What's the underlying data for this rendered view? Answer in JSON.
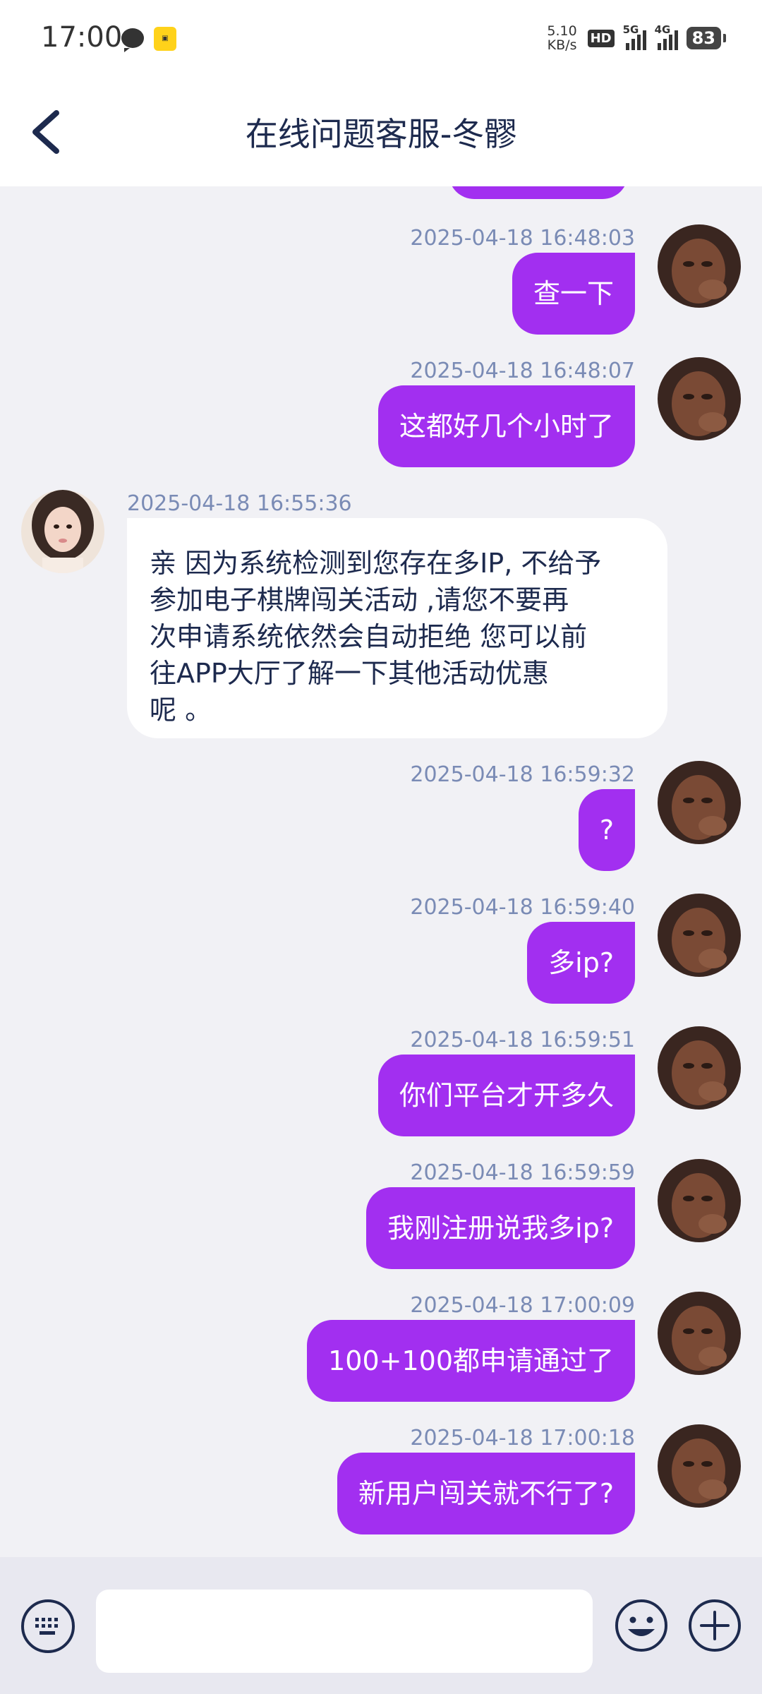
{
  "status": {
    "time": "17:00",
    "speed_top": "5.10",
    "speed_bottom": "KB/s",
    "hd": "HD",
    "net1": "5G",
    "net2": "4G",
    "battery": "83"
  },
  "header": {
    "title": "在线问题客服-冬髎"
  },
  "messages": [
    {
      "side": "right",
      "time": "2025-04-18 16:48:03",
      "text": "查一下"
    },
    {
      "side": "right",
      "time": "2025-04-18 16:48:07",
      "text": "这都好几个小时了"
    },
    {
      "side": "left",
      "time": "2025-04-18 16:55:36",
      "lines": [
        "亲 因为系统检测到您存在多IP, 不给予",
        "参加电子棋牌闯关活动 ,请您不要再",
        "次申请系统依然会自动拒绝  您可以前",
        "往APP大厅了解一下其他活动优惠",
        "呢  。"
      ]
    },
    {
      "side": "right",
      "time": "2025-04-18 16:59:32",
      "text": "?"
    },
    {
      "side": "right",
      "time": "2025-04-18 16:59:40",
      "text": "多ip?"
    },
    {
      "side": "right",
      "time": "2025-04-18 16:59:51",
      "text": "你们平台才开多久"
    },
    {
      "side": "right",
      "time": "2025-04-18 16:59:59",
      "text": "我刚注册说我多ip?"
    },
    {
      "side": "right",
      "time": "2025-04-18 17:00:09",
      "text": "100+100都申请通过了"
    },
    {
      "side": "right",
      "time": "2025-04-18 17:00:18",
      "text": "新用户闯关就不行了?"
    }
  ],
  "colors": {
    "accent_bubble": "#a22ff0",
    "background": "#f1f1f5",
    "timestamp": "#7a8bb5",
    "title": "#1d2a4e"
  }
}
